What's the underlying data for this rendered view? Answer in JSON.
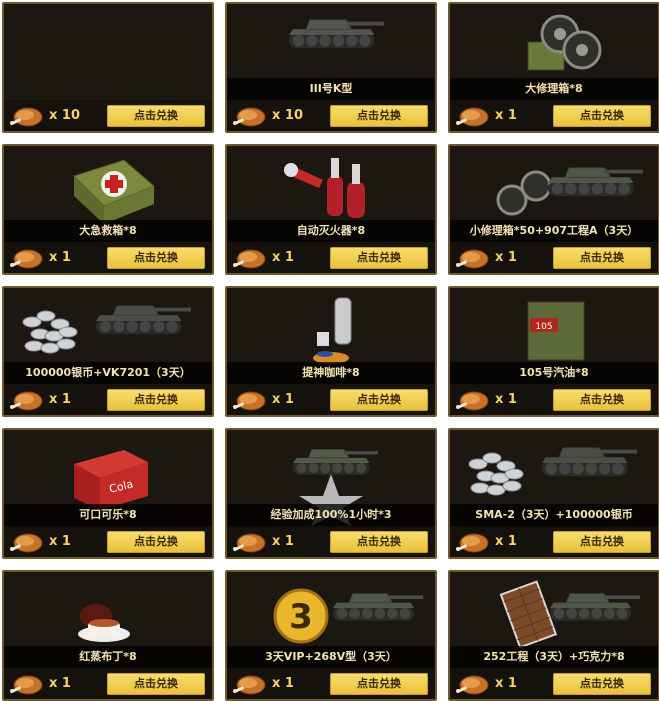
{
  "exchange_label": "点击兑换",
  "cards": [
    {
      "name": "",
      "qty": "x 10",
      "art": "blank-icon"
    },
    {
      "name": "III号K型",
      "qty": "x 10",
      "art": "tank-icon"
    },
    {
      "name": "大修理箱*8",
      "qty": "x 1",
      "art": "repair-kit-large-icon"
    },
    {
      "name": "大急救箱*8",
      "qty": "x 1",
      "art": "first-aid-kit-icon"
    },
    {
      "name": "自动灭火器*8",
      "qty": "x 1",
      "art": "fire-extinguisher-icon"
    },
    {
      "name": "小修理箱*50+907工程A（3天）",
      "qty": "x 1",
      "art": "tank-repair-icon"
    },
    {
      "name": "100000银币+VK7201（3天）",
      "qty": "x 1",
      "art": "silver-tank-icon"
    },
    {
      "name": "提神咖啡*8",
      "qty": "x 1",
      "art": "coffee-icon"
    },
    {
      "name": "105号汽油*8",
      "qty": "x 1",
      "art": "fuel-can-icon"
    },
    {
      "name": "可口可乐*8",
      "qty": "x 1",
      "art": "cola-cooler-icon"
    },
    {
      "name": "经验加成100%1小时*3",
      "qty": "x 1",
      "art": "xp-boost-icon"
    },
    {
      "name": "SMA-2（3天）+100000银币",
      "qty": "x 1",
      "art": "silver-tank-icon"
    },
    {
      "name": "红蒸布丁*8",
      "qty": "x 1",
      "art": "pudding-icon"
    },
    {
      "name": "3天VIP+268V型（3天）",
      "qty": "x 1",
      "art": "vip-tank-icon"
    },
    {
      "name": "252工程（3天）+巧克力*8",
      "qty": "x 1",
      "art": "chocolate-tank-icon"
    }
  ]
}
